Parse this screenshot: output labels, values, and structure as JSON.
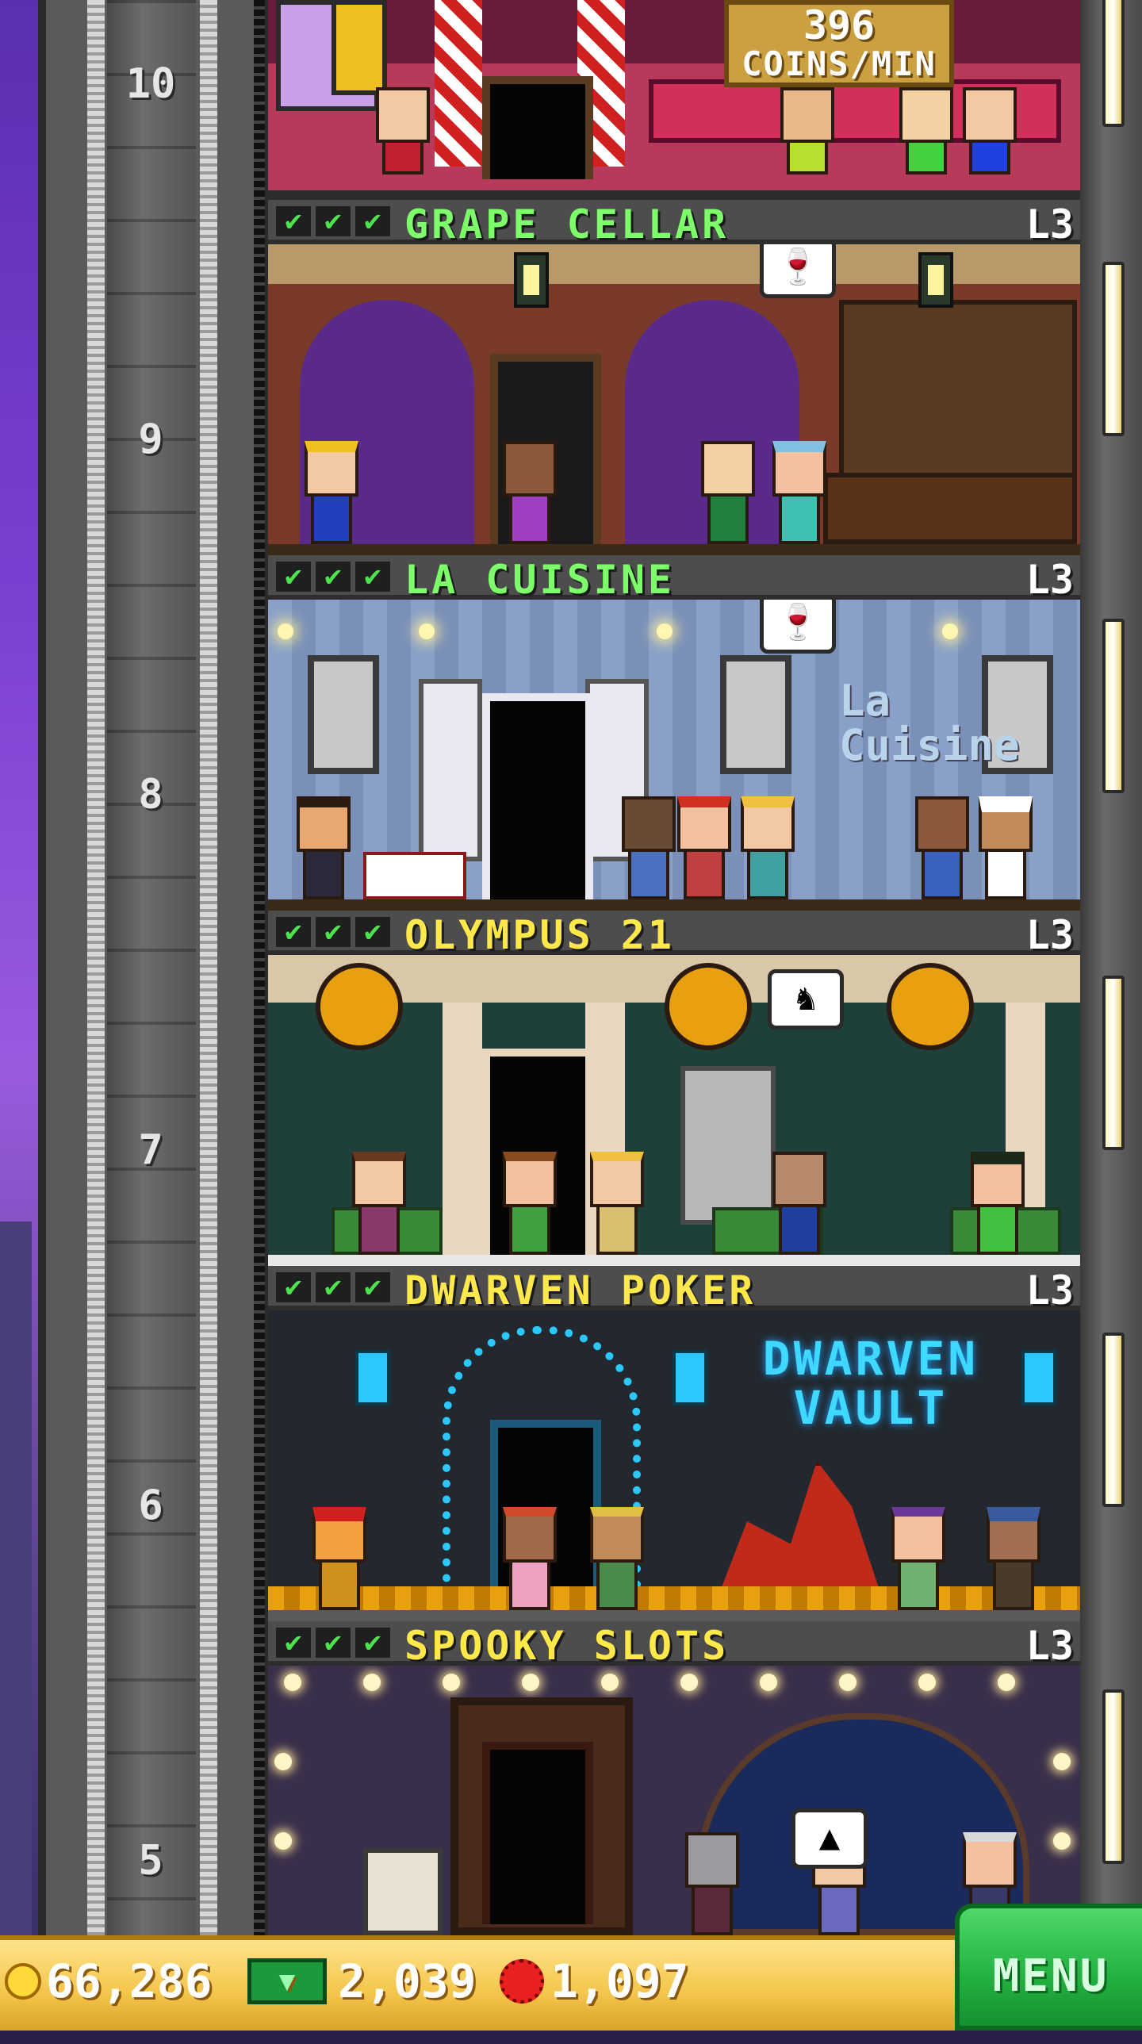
{
  "floors": [
    {
      "id": "top",
      "number": "10",
      "name": "",
      "level": ""
    },
    {
      "id": "grape",
      "number": "9",
      "name": "GRAPE CELLAR",
      "level": "L3",
      "name_color": "#7dff6a"
    },
    {
      "id": "cuisine",
      "number": "8",
      "name": "LA CUISINE",
      "level": "L3",
      "name_color": "#7dff6a"
    },
    {
      "id": "olympus",
      "number": "7",
      "name": "OLYMPUS 21",
      "level": "L3",
      "name_color": "#ffe84a"
    },
    {
      "id": "dwarven",
      "number": "6",
      "name": "DWARVEN POKER",
      "level": "L3",
      "name_color": "#ffe84a"
    },
    {
      "id": "spooky",
      "number": "5",
      "name": "SPOOKY SLOTS",
      "level": "L3",
      "name_color": "#ffe84a"
    }
  ],
  "top_floor": {
    "rate_value": "396",
    "rate_unit": "COINS/MIN"
  },
  "room_signs": {
    "cuisine_sign": "La Cuisine",
    "dwarven_sign_line1": "DWARVEN",
    "dwarven_sign_line2": "VAULT"
  },
  "checkmark": "✔",
  "resources": {
    "coins": "66,286",
    "bux": "2,039",
    "tickets": "1,097"
  },
  "menu_label": "MENU",
  "colors": {
    "grape_wall": "#7a3a2a",
    "cuisine_wall": "#8aa0c8",
    "olympus_wall": "#1f3f3a",
    "dwarven_wall": "#22282e",
    "spooky_wall": "#3a2f4a",
    "candy_wall": "#b83a5a"
  },
  "bubbles": {
    "grape": "wine-glass-icon",
    "cuisine": "wine-glass-icon",
    "olympus": "helmet-icon",
    "spooky": "witch-icon",
    "top": "candy-icon"
  }
}
